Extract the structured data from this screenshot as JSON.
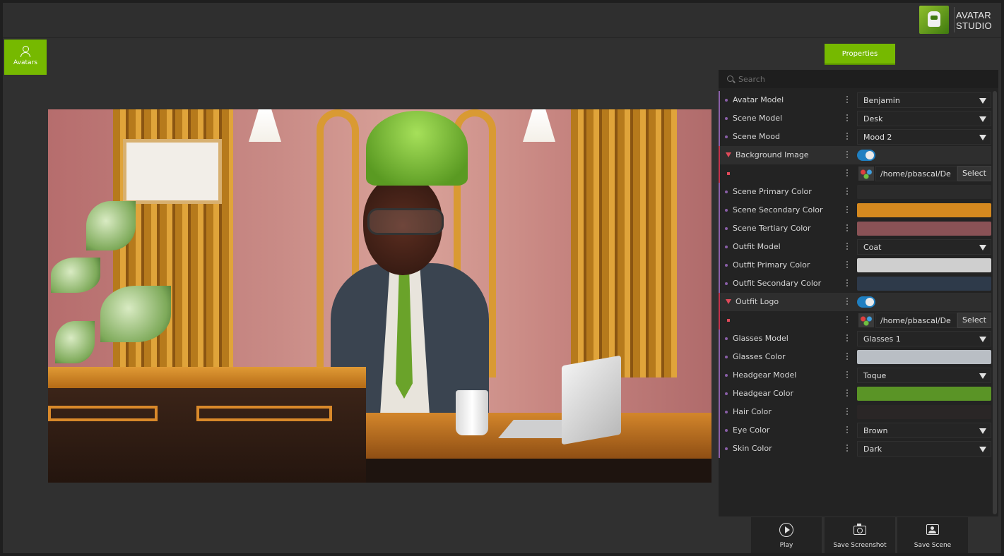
{
  "app": {
    "logo_text_line1": "AVATAR",
    "logo_text_line2": "STUDIO",
    "logo_icon": "avatar-studio-logo-icon"
  },
  "sidebar": {
    "avatars_label": "Avatars",
    "avatars_icon": "person-icon"
  },
  "properties_tab": {
    "label": "Properties"
  },
  "search": {
    "placeholder": "Search"
  },
  "rows": [
    {
      "label": "Avatar Model",
      "type": "combo",
      "value": "Benjamin"
    },
    {
      "label": "Scene Model",
      "type": "combo",
      "value": "Desk"
    },
    {
      "label": "Scene Mood",
      "type": "combo",
      "value": "Mood 2"
    },
    {
      "label": "Background Image",
      "type": "group",
      "toggle": true
    },
    {
      "label": "",
      "type": "file",
      "path": "/home/pbascal/De",
      "button": "Select"
    },
    {
      "label": "Scene Primary Color",
      "type": "color",
      "color": "#2b2b2b"
    },
    {
      "label": "Scene Secondary Color",
      "type": "color",
      "color": "#d5891f"
    },
    {
      "label": "Scene Tertiary Color",
      "type": "color",
      "color": "#8a5256"
    },
    {
      "label": "Outfit Model",
      "type": "combo",
      "value": "Coat"
    },
    {
      "label": "Outfit Primary Color",
      "type": "color",
      "color": "#cfcfcf"
    },
    {
      "label": "Outfit Secondary Color",
      "type": "color",
      "color": "#2e3a4a"
    },
    {
      "label": "Outfit Logo",
      "type": "group",
      "toggle": true
    },
    {
      "label": "",
      "type": "file",
      "path": "/home/pbascal/De",
      "button": "Select"
    },
    {
      "label": "Glasses Model",
      "type": "combo",
      "value": "Glasses 1"
    },
    {
      "label": "Glasses Color",
      "type": "color",
      "color": "#b9bec4"
    },
    {
      "label": "Headgear Model",
      "type": "combo",
      "value": "Toque"
    },
    {
      "label": "Headgear Color",
      "type": "color",
      "color": "#5a9426"
    },
    {
      "label": "Hair Color",
      "type": "color",
      "color": "#2a2626"
    },
    {
      "label": "Eye Color",
      "type": "combo",
      "value": "Brown"
    },
    {
      "label": "Skin Color",
      "type": "combo",
      "value": "Dark"
    }
  ],
  "bottom": {
    "play_label": "Play",
    "screenshot_label": "Save Screenshot",
    "scene_label": "Save Scene"
  }
}
